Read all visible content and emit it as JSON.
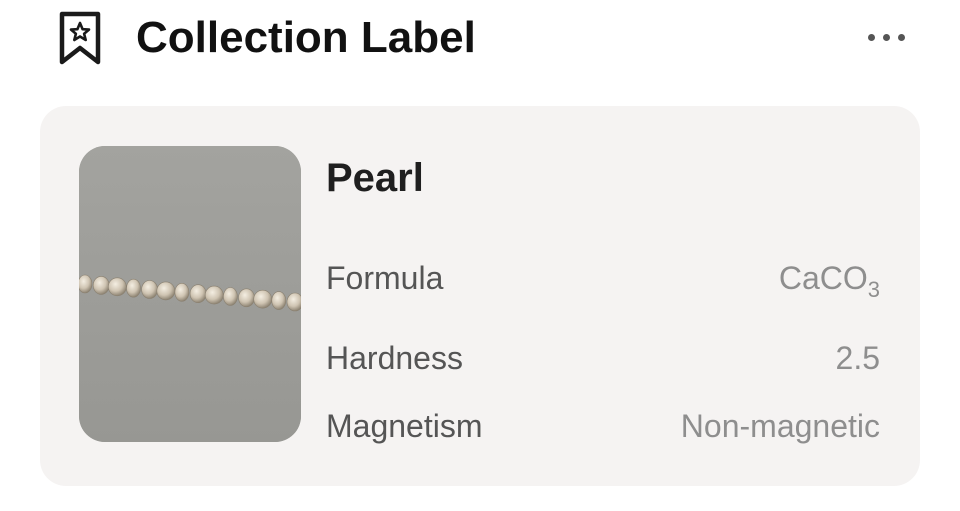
{
  "header": {
    "title": "Collection Label",
    "icon": "bookmark-star-icon",
    "more_icon": "more-horizontal-icon"
  },
  "card": {
    "image": "pearl-strand-photo",
    "name": "Pearl",
    "properties": [
      {
        "label": "Formula",
        "value_main": "CaCO",
        "value_sub": "3"
      },
      {
        "label": "Hardness",
        "value": "2.5"
      },
      {
        "label": "Magnetism",
        "value": "Non-magnetic"
      }
    ]
  },
  "colors": {
    "card_background": "#f5f3f2",
    "image_background": "#9d9d99"
  }
}
